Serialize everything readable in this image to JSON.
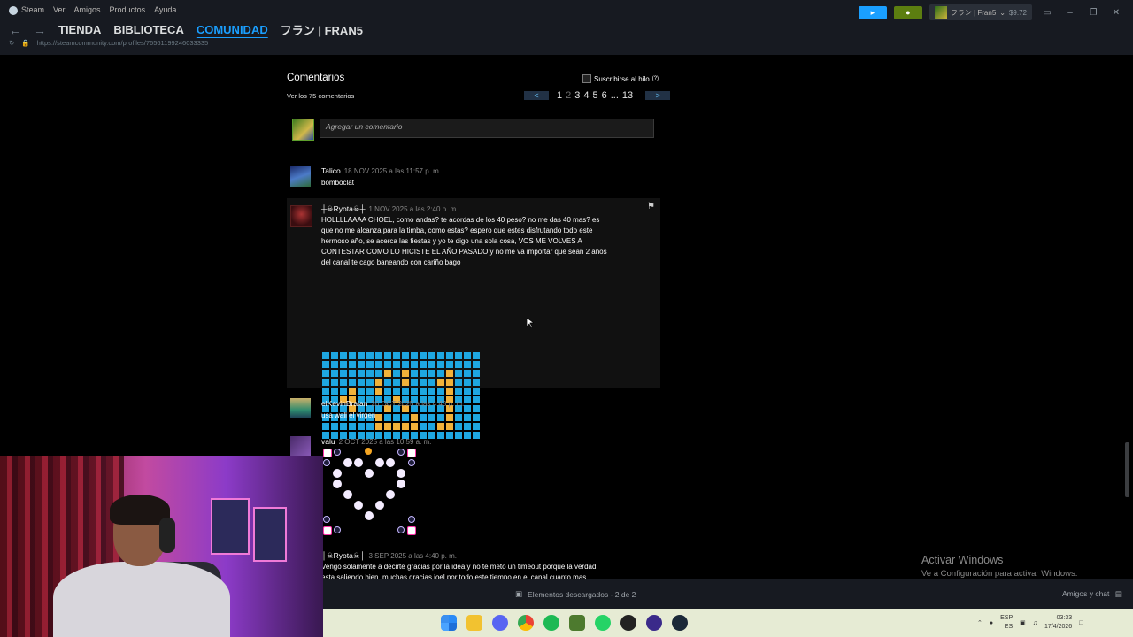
{
  "menu": {
    "app": "Steam",
    "items": [
      "Ver",
      "Amigos",
      "Productos",
      "Ayuda"
    ]
  },
  "nav": {
    "tabs": [
      "TIENDA",
      "BIBLIOTECA",
      "COMUNIDAD"
    ],
    "profile": "フラン | FRAN5",
    "active": "COMUNIDAD"
  },
  "url": "https://steamcommunity.com/profiles/76561199246033335",
  "account": {
    "name": "フラン | Fran5",
    "balance": "$9.72"
  },
  "comments_header": {
    "title": "Comentarios",
    "view_all": "Ver los 75 comentarios",
    "subscribe": "Suscribirse al hilo",
    "help": "(?)",
    "pager": {
      "prev": "<",
      "next": ">",
      "pages": [
        "1",
        "2",
        "3",
        "4",
        "5",
        "6",
        "...",
        "13"
      ],
      "current": "2"
    }
  },
  "new_comment_placeholder": "Agregar un comentario",
  "comments": [
    {
      "author": "Talico",
      "date": "18 NOV 2025 a las 11:57 p. m.",
      "text": "bomboclat"
    },
    {
      "author": "┼☠Ryota☠┼",
      "date": "1 NOV 2025 a las 2:40 p. m.",
      "lines": [
        "HOLLLLAAAA CHOEL, como andas? te acordas de los 40 peso? no me das 40 mas? es",
        "que no me alcanza para la timba, como estas? espero que estes disfrutando todo este",
        "hermoso año, se acerca las fiestas y yo te digo una sola cosa, VOS ME VOLVES A",
        "CONTESTAR COMO LO HICISTE EL AÑO PASADO y no me va importar que sean 2 años",
        "del canal te cago baneando con cariño bago"
      ]
    },
    {
      "author": "elKevinBraian",
      "date": "26 OCT 2025 a las 4:48 p. m.",
      "text": "usa wall el virgen"
    },
    {
      "author": "valu",
      "date": "2 OCT 2025 a las 10:59 a. m."
    },
    {
      "author": "┼☠Ryota☠┼",
      "date": "3 SEP 2025 a las 4:40 p. m.",
      "lines": [
        "Vengo solamente a decirte gracias por la idea y no te meto un timeout porque la verdad",
        "esta saliendo bien, muchas gracias joel por todo este tiempo en el canal cuanto mas"
      ]
    }
  ],
  "watermark": {
    "title": "Activar Windows",
    "subtitle": "Ve a Configuración para activar Windows."
  },
  "bottom": {
    "downloads": "Elementos descargados - 2 de 2",
    "friends": "Amigos y chat"
  },
  "tray": {
    "lang1": "ESP",
    "lang2": "ES",
    "time": "03:33",
    "date": "17/4/2026"
  },
  "colors": {
    "accent": "#1a9fff",
    "pixel_blue": "#1ea6e0",
    "pixel_orange": "#f2b23a"
  },
  "pixel_art_rows": [
    "BBBBBBBBBBBBBBBBBB",
    "BBBBBBBBBBBBBBBBBB",
    "BBBBBBBOBOBBBBOBBB",
    "BBBBBBOBBOBBBOOBBB",
    "BBBOBBOBBBBBBBOBBB",
    "BBOOBBBBOBBBBBOBBB",
    "BBBOBBBOBOBBBBOBBB",
    "BBBBBBOBBBOBBBOBBB",
    "BBBBBBOOOOOBBOOBBB",
    "BBBBBBBBBBBBBBBBBB"
  ]
}
